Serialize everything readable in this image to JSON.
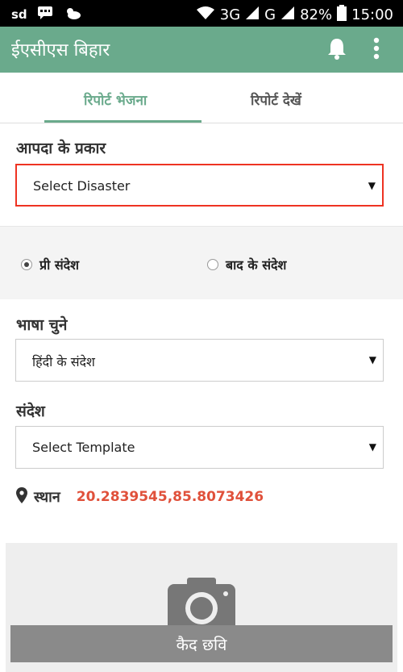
{
  "status_bar": {
    "carrier_mark": "sd",
    "network_1": "3G",
    "network_2": "G",
    "battery": "82%",
    "time": "15:00"
  },
  "app_bar": {
    "title": "ईएसीएस बिहार",
    "icons": [
      "bell-icon",
      "more-vert-icon"
    ],
    "color": "#6aaa8c"
  },
  "tabs": [
    {
      "label": "रिपोर्ट भेजना",
      "active": true
    },
    {
      "label": "रिपोर्ट देखें",
      "active": false
    }
  ],
  "disaster": {
    "label": "आपदा के प्रकार",
    "selected": "Select Disaster",
    "error_color": "#e32222"
  },
  "message_type": {
    "options": [
      {
        "label": "प्री संदेश",
        "selected": true
      },
      {
        "label": "बाद के संदेश",
        "selected": false
      }
    ]
  },
  "language": {
    "label": "भाषा चुने",
    "selected": "हिंदी के संदेश"
  },
  "template": {
    "label": "संदेश",
    "selected": "Select Template"
  },
  "location": {
    "label": "स्थान",
    "value": "20.2839545,85.8073426",
    "value_color": "#e0513b"
  },
  "capture": {
    "button_label": "कैद छवि",
    "icon": "camera-icon"
  }
}
